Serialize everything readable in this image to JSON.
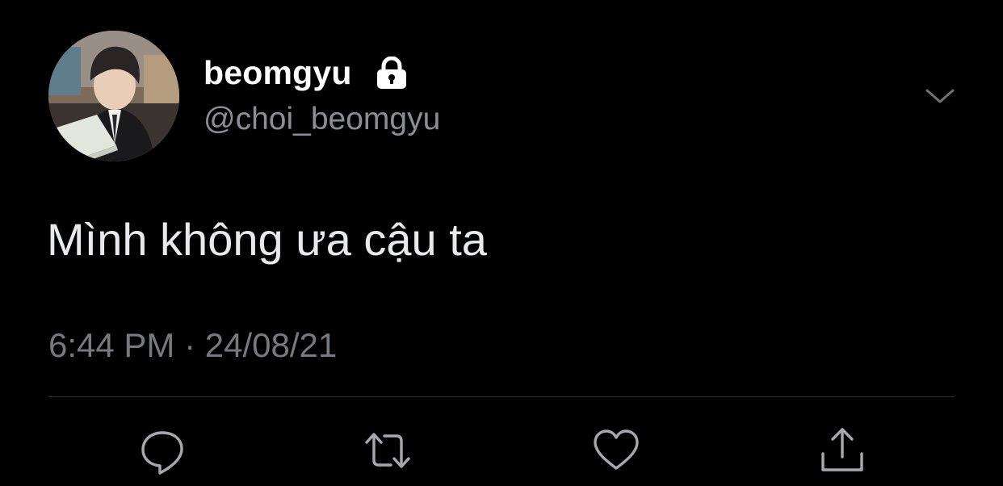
{
  "tweet": {
    "display_name": "beomgyu",
    "handle": "@choi_beomgyu",
    "text": "Mình không ưa cậu ta",
    "timestamp": "6:44 PM · 24/08/21"
  },
  "icons": {
    "protected": "lock-icon",
    "menu": "chevron-down-icon",
    "reply": "reply-icon",
    "retweet": "retweet-icon",
    "like": "heart-icon",
    "share": "share-icon"
  },
  "colors": {
    "background": "#000000",
    "primary_text": "#e7e9ea",
    "secondary_text": "#8b8f94",
    "divider": "#2f3336"
  }
}
